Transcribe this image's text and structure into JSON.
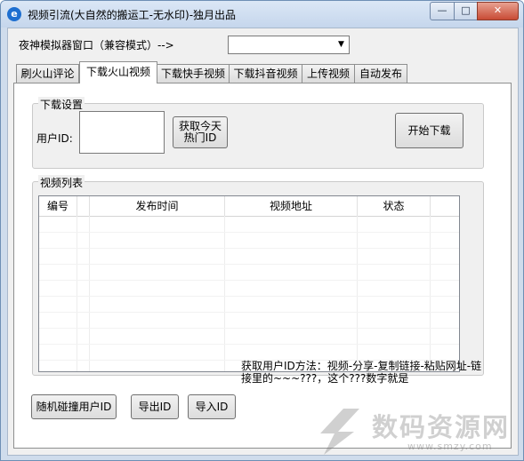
{
  "window": {
    "title": "视频引流(大自然的搬运工-无水印)-独月出品",
    "app_icon": "e-icon",
    "controls": {
      "minimize": "—",
      "maximize": "□",
      "close": "✕"
    }
  },
  "emulator": {
    "label": "夜神模拟器窗口（兼容模式）-->",
    "selected": ""
  },
  "tabs": [
    {
      "label": "刷火山评论"
    },
    {
      "label": "下载火山视频"
    },
    {
      "label": "下载快手视频"
    },
    {
      "label": "下载抖音视频"
    },
    {
      "label": "上传视频"
    },
    {
      "label": "自动发布"
    }
  ],
  "download_settings": {
    "title": "下载设置",
    "user_id_label": "用户ID:",
    "user_id_value": "",
    "get_hot_id_line1": "获取今天",
    "get_hot_id_line2": "热门ID",
    "start_download": "开始下载"
  },
  "video_list": {
    "title": "视频列表",
    "columns": [
      "编号",
      "发布时间",
      "视频地址",
      "状态"
    ],
    "rows": []
  },
  "bottom_buttons": {
    "random_collide": "随机碰撞用户ID",
    "export_id": "导出ID",
    "import_id": "导入ID"
  },
  "info_text": "获取用户ID方法：视频-分享-复制链接-粘贴网址-链接里的~~~???，这个???数字就是",
  "watermark": {
    "text": "数码资源网",
    "url": "www.smzy.com"
  },
  "colors": {
    "titlebar": "#c5d6ec",
    "window_border": "#6e8fb5",
    "close_button": "#c84b35",
    "client_bg": "#f0f0f0"
  }
}
